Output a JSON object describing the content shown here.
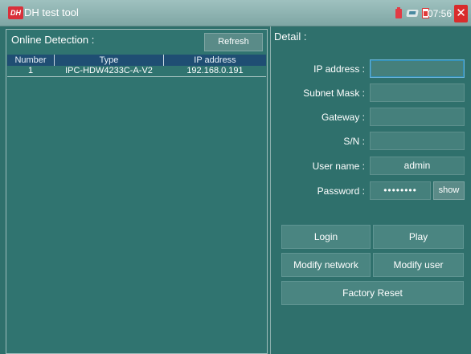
{
  "titlebar": {
    "logo_text": "DH",
    "app_title": "DH test tool",
    "time": "07:56",
    "close_symbol": "✕",
    "icons": [
      "battery-icon",
      "network-icon",
      "sd-card-icon",
      "close-icon"
    ]
  },
  "online": {
    "title": "Online Detection :",
    "refresh_label": "Refresh",
    "columns": [
      "Number",
      "Type",
      "IP address"
    ],
    "rows": [
      {
        "number": "1",
        "type": "IPC-HDW4233C-A-V2",
        "ip": "192.168.0.191"
      }
    ]
  },
  "detail": {
    "title": "Detail :",
    "fields": {
      "ip_label": "IP address :",
      "ip_value": "",
      "subnet_label": "Subnet Mask :",
      "subnet_value": "",
      "gateway_label": "Gateway :",
      "gateway_value": "",
      "sn_label": "S/N :",
      "sn_value": "",
      "username_label": "User name :",
      "username_value": "admin",
      "password_label": "Password :",
      "password_value": "••••••••",
      "show_label": "show"
    },
    "buttons": {
      "login": "Login",
      "play": "Play",
      "modify_network": "Modify network",
      "modify_user": "Modify user",
      "factory_reset": "Factory Reset"
    }
  },
  "colors": {
    "background": "#2f706c",
    "table_header": "#1f4e73",
    "close": "#d92c2c"
  }
}
